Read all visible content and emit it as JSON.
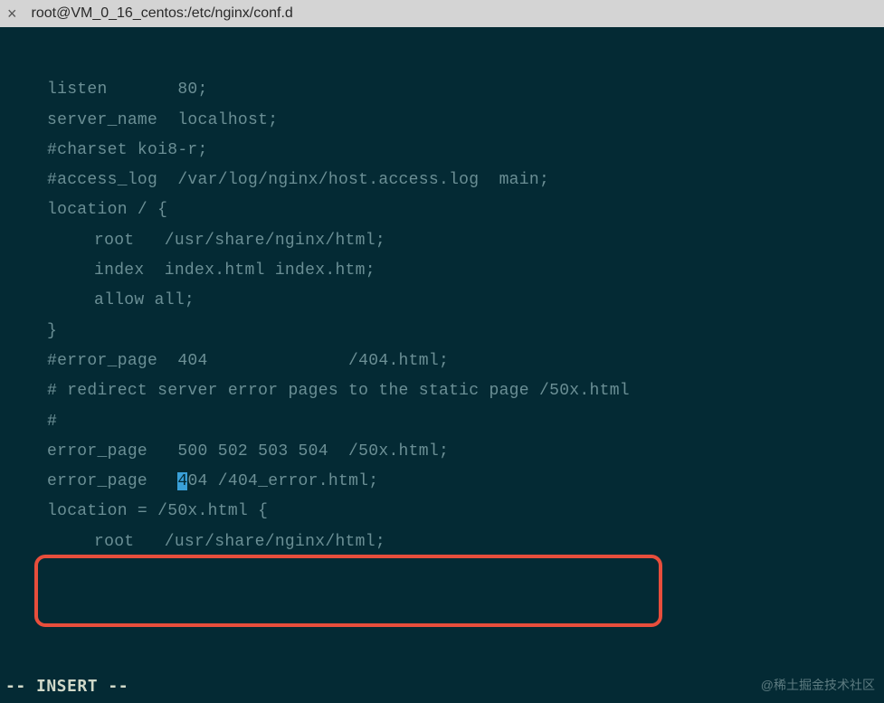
{
  "titlebar": {
    "close_label": "×",
    "title": "root@VM_0_16_centos:/etc/nginx/conf.d"
  },
  "editor": {
    "lines": {
      "l1a": "listen       80;",
      "l1b": "server_name  localhost;",
      "l2": "",
      "l3": "#charset koi8-r;",
      "l4": "#access_log  /var/log/nginx/host.access.log  main;",
      "l5": "",
      "l6": "location / {",
      "l7": "root   /usr/share/nginx/html;",
      "l8": "index  index.html index.htm;",
      "l9": "allow all;",
      "l10": "}",
      "l11": "",
      "l12": "#error_page  404              /404.html;",
      "l13": "",
      "l14": "# redirect server error pages to the static page /50x.html",
      "l15": "#",
      "l16": "error_page   500 502 503 504  /50x.html;",
      "l17_pre": "error_page   ",
      "l17_cursor": "4",
      "l17_post": "04 /404_error.html;",
      "l18": "location = /50x.html {",
      "l19": "root   /usr/share/nginx/html;"
    }
  },
  "status": {
    "mode": "-- INSERT --"
  },
  "watermark": {
    "text": "@稀土掘金技术社区"
  }
}
